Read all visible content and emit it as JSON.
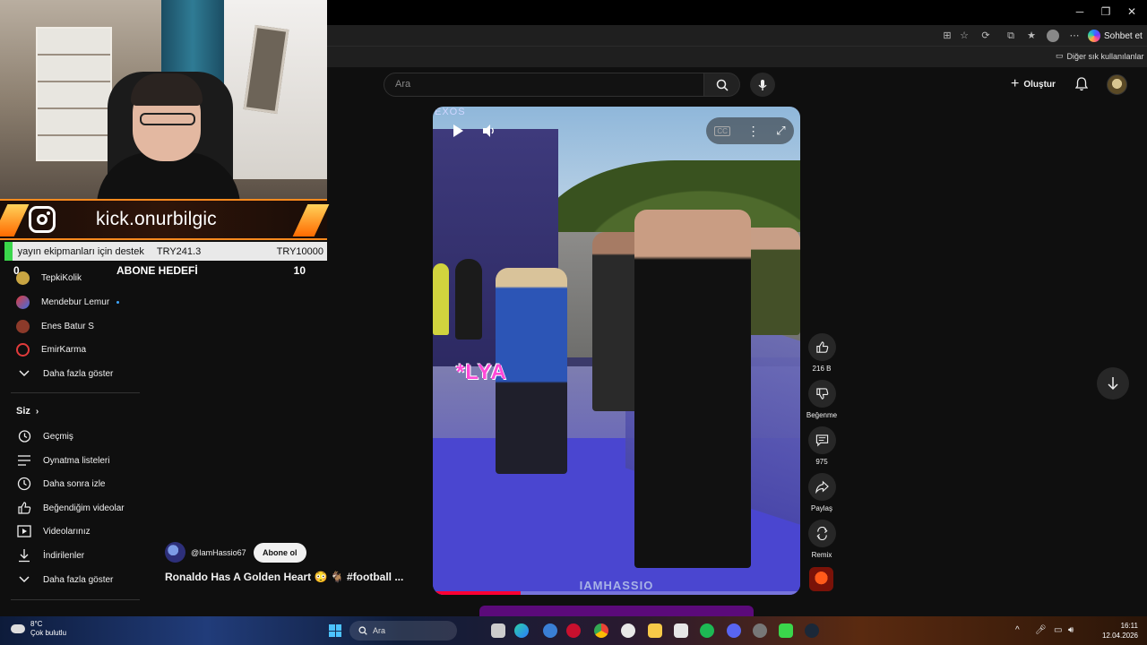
{
  "browser": {
    "copilot_label": "Sohbet et",
    "bookmarks_other": "Diğer sık kullanılanlar",
    "window_controls": [
      "minimize",
      "maximize",
      "close"
    ]
  },
  "header": {
    "search_placeholder": "Ara",
    "create_label": "Oluştur"
  },
  "overlay": {
    "kick_handle": "kick.onurbilgic",
    "donation_label": "yayın ekipmanları için destek",
    "donation_current": "TRY241.3",
    "donation_goal": "TRY10000",
    "donation_progress_fraction": 0.024,
    "sub_goal_current": "0",
    "sub_goal_title": "ABONE HEDEFİ",
    "sub_goal_target": "10"
  },
  "sidebar": {
    "subscriptions": [
      {
        "label": "TepkiKolik"
      },
      {
        "label": "Mendebur Lemur"
      },
      {
        "label": "Enes Batur S"
      },
      {
        "label": "EmirKarma"
      }
    ],
    "show_more_1": "Daha fazla göster",
    "you_section": "Siz",
    "you_items": [
      {
        "label": "Geçmiş",
        "icon": "history-icon"
      },
      {
        "label": "Oynatma listeleri",
        "icon": "playlist-icon"
      },
      {
        "label": "Daha sonra izle",
        "icon": "clock-icon"
      },
      {
        "label": "Beğendiğim videolar",
        "icon": "thumb-up-icon"
      },
      {
        "label": "Videolarınız",
        "icon": "video-icon"
      },
      {
        "label": "İndirilenler",
        "icon": "download-icon"
      }
    ],
    "show_more_2": "Daha fazla göster"
  },
  "video": {
    "overlay_text": "*LYA",
    "watermark": "IAMHASSIO",
    "sponsor": "EXOS",
    "progress_fraction": 0.24
  },
  "actions": {
    "like_count": "216 B",
    "dislike_label": "Beğenme",
    "comment_count": "975",
    "share_label": "Paylaş",
    "remix_label": "Remix"
  },
  "short_info": {
    "channel": "@IamHassio67",
    "subscribe_label": "Abone ol",
    "title": "Ronaldo Has A Golden Heart 😳 🐐 #football ..."
  },
  "taskbar": {
    "temperature": "8°C",
    "weather": "Çok bulutlu",
    "search_label": "Ara",
    "time": "16:11",
    "date": "12.04.2026"
  }
}
